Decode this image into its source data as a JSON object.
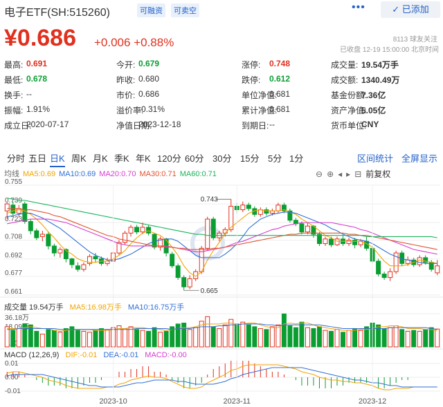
{
  "header": {
    "title": "电子ETF(SH:515260)",
    "tag_margin": "可融资",
    "tag_short": "可卖空",
    "more": "•••",
    "added_button": "✓ 已添加"
  },
  "quote": {
    "price": "¥0.686",
    "change": "+0.006 +0.88%",
    "followers": "8113 球友关注",
    "status": "已收盘 12-19 15:00:00 北京时间"
  },
  "stats": [
    {
      "label": "最高:",
      "value": "0.691",
      "tone": "red"
    },
    {
      "label": "今开:",
      "value": "0.679",
      "tone": "green"
    },
    {
      "label": "涨停:",
      "value": "0.748",
      "tone": "red"
    },
    {
      "label": "成交量:",
      "value": "19.54万手",
      "tone": "bold"
    },
    {
      "label": "最低:",
      "value": "0.678",
      "tone": "green"
    },
    {
      "label": "昨收:",
      "value": "0.680",
      "tone": "plain"
    },
    {
      "label": "跌停:",
      "value": "0.612",
      "tone": "green"
    },
    {
      "label": "成交额:",
      "value": "1340.49万",
      "tone": "bold"
    },
    {
      "label": "换手:",
      "value": "--",
      "tone": "plain"
    },
    {
      "label": "市价:",
      "value": "0.686",
      "tone": "plain"
    },
    {
      "label": "单位净值:",
      "value": "0.681",
      "tone": "plain"
    },
    {
      "label": "基金份额:",
      "value": "7.36亿",
      "tone": "bold"
    },
    {
      "label": "振幅:",
      "value": "1.91%",
      "tone": "plain"
    },
    {
      "label": "溢价率:",
      "value": "-0.31%",
      "tone": "plain"
    },
    {
      "label": "累计净值:",
      "value": "0.681",
      "tone": "plain"
    },
    {
      "label": "资产净值:",
      "value": "5.05亿",
      "tone": "bold"
    },
    {
      "label": "成立日:",
      "value": "2020-07-17",
      "tone": "plain"
    },
    {
      "label": "净值日期:",
      "value": "2023-12-18",
      "tone": "plain"
    },
    {
      "label": "到期日:",
      "value": "--",
      "tone": "plain"
    },
    {
      "label": "货币单位:",
      "value": "CNY",
      "tone": "bold"
    }
  ],
  "tabs": [
    "分时",
    "五日",
    "日K",
    "周K",
    "月K",
    "季K",
    "年K",
    "120分",
    "60分",
    "30分",
    "15分",
    "5分",
    "1分"
  ],
  "active_tab": "日K",
  "tab_links": [
    "区间统计",
    "全屏显示"
  ],
  "ma_legend": {
    "label": "均线",
    "items": [
      {
        "text": "MA5:0.69",
        "color": "#f2a300"
      },
      {
        "text": "MA10:0.69",
        "color": "#2f6fd6"
      },
      {
        "text": "MA20:0.70",
        "color": "#d83ad0"
      },
      {
        "text": "MA30:0.71",
        "color": "#e0532e"
      },
      {
        "text": "MA60:0.71",
        "color": "#19b35a"
      }
    ]
  },
  "tools": {
    "icons": [
      "⊖",
      "⊕",
      "◂",
      "▸",
      "⊟"
    ],
    "fq": "前复权"
  },
  "volume_legend": {
    "label": "成交量 19.54万手",
    "ma5": "MA5:16.98万手",
    "ma10": "MA10:16.75万手",
    "ma5_color": "#f2a300",
    "ma10_color": "#2f6fd6"
  },
  "macd_legend": {
    "label": "MACD (12,26,9)",
    "dif": "DIF:-0.01",
    "dea": "DEA:-0.01",
    "macd": "MACD:-0.00",
    "dif_color": "#f2a300",
    "dea_color": "#2f6fd6",
    "macd_color": "#d83ad0"
  },
  "chart_data": {
    "type": "candlestick",
    "y_ticks": [
      "0.755",
      "0.739",
      "0.723",
      "0.708",
      "0.692",
      "0.677",
      "0.661"
    ],
    "ylim": [
      0.661,
      0.755
    ],
    "annotations": [
      {
        "text": "0.743"
      },
      {
        "text": "0.665"
      }
    ],
    "volume_ticks": [
      "36.18万",
      "18.09万",
      "0.00"
    ],
    "volume_ylim": [
      0,
      36.18
    ],
    "macd_ticks": [
      "0.01",
      "0.00",
      "-0.01"
    ],
    "macd_ylim": [
      -0.012,
      0.012
    ],
    "x_labels": [
      "2023-10",
      "2023-11",
      "2023-12"
    ],
    "colors": {
      "up": "#e0301e",
      "down": "#0a9e32"
    },
    "candles": [
      [
        0.733,
        0.739,
        0.74,
        0.726
      ],
      [
        0.738,
        0.731,
        0.741,
        0.729
      ],
      [
        0.731,
        0.735,
        0.738,
        0.728
      ],
      [
        0.739,
        0.724,
        0.741,
        0.722
      ],
      [
        0.724,
        0.716,
        0.726,
        0.713
      ],
      [
        0.716,
        0.71,
        0.718,
        0.708
      ],
      [
        0.711,
        0.713,
        0.716,
        0.707
      ],
      [
        0.713,
        0.703,
        0.715,
        0.7
      ],
      [
        0.703,
        0.697,
        0.705,
        0.694
      ],
      [
        0.697,
        0.7,
        0.702,
        0.693
      ],
      [
        0.7,
        0.692,
        0.701,
        0.689
      ],
      [
        0.692,
        0.687,
        0.693,
        0.684
      ],
      [
        0.686,
        0.683,
        0.689,
        0.681
      ],
      [
        0.683,
        0.687,
        0.689,
        0.681
      ],
      [
        0.688,
        0.694,
        0.696,
        0.686
      ],
      [
        0.694,
        0.692,
        0.697,
        0.689
      ],
      [
        0.692,
        0.688,
        0.694,
        0.686
      ],
      [
        0.688,
        0.69,
        0.693,
        0.686
      ],
      [
        0.69,
        0.697,
        0.699,
        0.688
      ],
      [
        0.697,
        0.706,
        0.708,
        0.695
      ],
      [
        0.706,
        0.714,
        0.716,
        0.704
      ],
      [
        0.714,
        0.719,
        0.721,
        0.711
      ],
      [
        0.719,
        0.715,
        0.721,
        0.713
      ],
      [
        0.715,
        0.719,
        0.723,
        0.713
      ],
      [
        0.719,
        0.714,
        0.721,
        0.712
      ],
      [
        0.713,
        0.702,
        0.714,
        0.7
      ],
      [
        0.702,
        0.709,
        0.711,
        0.699
      ],
      [
        0.709,
        0.697,
        0.71,
        0.694
      ],
      [
        0.696,
        0.686,
        0.698,
        0.684
      ],
      [
        0.686,
        0.676,
        0.688,
        0.674
      ],
      [
        0.676,
        0.668,
        0.678,
        0.665
      ],
      [
        0.668,
        0.675,
        0.678,
        0.666
      ],
      [
        0.675,
        0.681,
        0.683,
        0.673
      ],
      [
        0.681,
        0.701,
        0.703,
        0.679
      ],
      [
        0.701,
        0.726,
        0.728,
        0.699
      ],
      [
        0.726,
        0.71,
        0.728,
        0.708
      ],
      [
        0.71,
        0.714,
        0.716,
        0.707
      ],
      [
        0.714,
        0.717,
        0.719,
        0.711
      ],
      [
        0.717,
        0.737,
        0.743,
        0.715
      ],
      [
        0.737,
        0.734,
        0.74,
        0.731
      ],
      [
        0.734,
        0.738,
        0.741,
        0.732
      ],
      [
        0.738,
        0.735,
        0.74,
        0.733
      ],
      [
        0.735,
        0.73,
        0.737,
        0.728
      ],
      [
        0.73,
        0.734,
        0.736,
        0.728
      ],
      [
        0.734,
        0.731,
        0.736,
        0.729
      ],
      [
        0.731,
        0.733,
        0.735,
        0.729
      ],
      [
        0.733,
        0.738,
        0.74,
        0.731
      ],
      [
        0.738,
        0.733,
        0.74,
        0.731
      ],
      [
        0.733,
        0.725,
        0.735,
        0.723
      ],
      [
        0.725,
        0.722,
        0.727,
        0.72
      ],
      [
        0.722,
        0.715,
        0.724,
        0.713
      ],
      [
        0.715,
        0.72,
        0.723,
        0.713
      ],
      [
        0.72,
        0.713,
        0.721,
        0.71
      ],
      [
        0.713,
        0.705,
        0.715,
        0.703
      ],
      [
        0.705,
        0.709,
        0.711,
        0.703
      ],
      [
        0.709,
        0.704,
        0.711,
        0.702
      ],
      [
        0.704,
        0.709,
        0.711,
        0.703
      ],
      [
        0.709,
        0.705,
        0.712,
        0.703
      ],
      [
        0.705,
        0.708,
        0.71,
        0.703
      ],
      [
        0.708,
        0.704,
        0.71,
        0.701
      ],
      [
        0.704,
        0.707,
        0.709,
        0.702
      ],
      [
        0.707,
        0.701,
        0.711,
        0.699
      ],
      [
        0.701,
        0.69,
        0.703,
        0.688
      ],
      [
        0.69,
        0.679,
        0.692,
        0.677
      ],
      [
        0.679,
        0.676,
        0.681,
        0.674
      ],
      [
        0.676,
        0.681,
        0.684,
        0.673
      ],
      [
        0.681,
        0.697,
        0.699,
        0.679
      ],
      [
        0.697,
        0.688,
        0.699,
        0.686
      ],
      [
        0.688,
        0.691,
        0.694,
        0.686
      ],
      [
        0.691,
        0.687,
        0.693,
        0.685
      ],
      [
        0.687,
        0.693,
        0.695,
        0.685
      ],
      [
        0.693,
        0.689,
        0.695,
        0.687
      ],
      [
        0.689,
        0.683,
        0.691,
        0.681
      ],
      [
        0.68,
        0.686,
        0.691,
        0.678
      ]
    ],
    "ma5": [
      0.731,
      0.733,
      0.734,
      0.733,
      0.73,
      0.726,
      0.721,
      0.715,
      0.71,
      0.704,
      0.699,
      0.696,
      0.692,
      0.69,
      0.689,
      0.689,
      0.69,
      0.69,
      0.692,
      0.695,
      0.699,
      0.705,
      0.71,
      0.714,
      0.716,
      0.714,
      0.712,
      0.708,
      0.702,
      0.695,
      0.686,
      0.68,
      0.677,
      0.681,
      0.691,
      0.699,
      0.706,
      0.714,
      0.719,
      0.723,
      0.727,
      0.731,
      0.733,
      0.734,
      0.733,
      0.733,
      0.733,
      0.734,
      0.732,
      0.73,
      0.726,
      0.723,
      0.72,
      0.716,
      0.712,
      0.71,
      0.707,
      0.707,
      0.707,
      0.707,
      0.707,
      0.705,
      0.702,
      0.696,
      0.69,
      0.686,
      0.686,
      0.686,
      0.687,
      0.689,
      0.691,
      0.69,
      0.689,
      0.688
    ],
    "ma10": [
      0.728,
      0.729,
      0.73,
      0.731,
      0.731,
      0.729,
      0.727,
      0.724,
      0.721,
      0.718,
      0.714,
      0.71,
      0.706,
      0.702,
      0.698,
      0.695,
      0.693,
      0.691,
      0.691,
      0.692,
      0.694,
      0.696,
      0.699,
      0.702,
      0.705,
      0.707,
      0.708,
      0.709,
      0.709,
      0.707,
      0.703,
      0.699,
      0.695,
      0.693,
      0.693,
      0.693,
      0.693,
      0.696,
      0.7,
      0.705,
      0.711,
      0.718,
      0.722,
      0.726,
      0.728,
      0.73,
      0.731,
      0.732,
      0.732,
      0.731,
      0.729,
      0.727,
      0.725,
      0.723,
      0.721,
      0.718,
      0.716,
      0.713,
      0.711,
      0.709,
      0.708,
      0.707,
      0.705,
      0.702,
      0.699,
      0.696,
      0.694,
      0.692,
      0.691,
      0.69,
      0.689,
      0.688,
      0.688,
      0.688
    ],
    "ma20": [
      0.722,
      0.723,
      0.724,
      0.725,
      0.726,
      0.726,
      0.726,
      0.726,
      0.725,
      0.724,
      0.723,
      0.721,
      0.719,
      0.717,
      0.715,
      0.713,
      0.711,
      0.709,
      0.707,
      0.705,
      0.704,
      0.703,
      0.703,
      0.703,
      0.703,
      0.703,
      0.703,
      0.703,
      0.702,
      0.701,
      0.7,
      0.699,
      0.698,
      0.698,
      0.699,
      0.7,
      0.701,
      0.702,
      0.704,
      0.706,
      0.707,
      0.709,
      0.711,
      0.713,
      0.715,
      0.717,
      0.718,
      0.72,
      0.721,
      0.722,
      0.723,
      0.723,
      0.723,
      0.723,
      0.723,
      0.723,
      0.722,
      0.721,
      0.72,
      0.719,
      0.717,
      0.716,
      0.714,
      0.712,
      0.71,
      0.708,
      0.706,
      0.704,
      0.702,
      0.7,
      0.699,
      0.698,
      0.697,
      0.696
    ],
    "ma30": [
      0.735,
      0.735,
      0.735,
      0.734,
      0.734,
      0.733,
      0.732,
      0.731,
      0.729,
      0.728,
      0.726,
      0.724,
      0.722,
      0.72,
      0.718,
      0.716,
      0.714,
      0.712,
      0.711,
      0.709,
      0.708,
      0.707,
      0.706,
      0.705,
      0.704,
      0.703,
      0.703,
      0.702,
      0.702,
      0.701,
      0.701,
      0.7,
      0.7,
      0.7,
      0.7,
      0.701,
      0.701,
      0.702,
      0.703,
      0.704,
      0.705,
      0.706,
      0.707,
      0.708,
      0.709,
      0.71,
      0.711,
      0.712,
      0.713,
      0.713,
      0.714,
      0.714,
      0.714,
      0.714,
      0.714,
      0.714,
      0.714,
      0.714,
      0.713,
      0.713,
      0.712,
      0.712,
      0.711,
      0.71,
      0.709,
      0.708,
      0.707,
      0.706,
      0.705,
      0.704,
      0.703,
      0.702,
      0.701,
      0.7
    ],
    "ma60": [
      0.744,
      0.743,
      0.742,
      0.742,
      0.741,
      0.74,
      0.739,
      0.738,
      0.737,
      0.736,
      0.735,
      0.734,
      0.733,
      0.732,
      0.731,
      0.73,
      0.729,
      0.728,
      0.727,
      0.726,
      0.725,
      0.724,
      0.723,
      0.722,
      0.721,
      0.72,
      0.719,
      0.718,
      0.717,
      0.716,
      0.715,
      0.714,
      0.713,
      0.713,
      0.712,
      0.712,
      0.712,
      0.712,
      0.712,
      0.712,
      0.712,
      0.712,
      0.712,
      0.712,
      0.712,
      0.712,
      0.712,
      0.712,
      0.712,
      0.712,
      0.712,
      0.712,
      0.712,
      0.712,
      0.712,
      0.712,
      0.712,
      0.712,
      0.712,
      0.712,
      0.712,
      0.711,
      0.711,
      0.711,
      0.711,
      0.711,
      0.711,
      0.711,
      0.711,
      0.711,
      0.711,
      0.711,
      0.711,
      0.71
    ],
    "volume": [
      22,
      18,
      20,
      25,
      24,
      17,
      14,
      19,
      18,
      16,
      20,
      22,
      18,
      17,
      16,
      18,
      20,
      19,
      21,
      23,
      20,
      22,
      19,
      18,
      17,
      21,
      16,
      17,
      22,
      25,
      26,
      19,
      21,
      28,
      33,
      22,
      20,
      24,
      30,
      25,
      27,
      24,
      22,
      20,
      19,
      22,
      24,
      36,
      23,
      21,
      27,
      21,
      20,
      22,
      18,
      17,
      19,
      16,
      18,
      20,
      18,
      22,
      26,
      24,
      20,
      21,
      23,
      19,
      17,
      18,
      17,
      19,
      21,
      19.5
    ],
    "vol_ma5": [
      20,
      20,
      20,
      21,
      22,
      21,
      20,
      20,
      18,
      17,
      18,
      19,
      19,
      19,
      19,
      18,
      18,
      18,
      19,
      20,
      20,
      21,
      21,
      21,
      20,
      20,
      19,
      18,
      19,
      20,
      21,
      21,
      22,
      24,
      25,
      25,
      25,
      26,
      26,
      24,
      25,
      26,
      26,
      24,
      22,
      21,
      21,
      25,
      26,
      25,
      26,
      26,
      24,
      22,
      21,
      20,
      19,
      18,
      18,
      18,
      19,
      19,
      20,
      22,
      22,
      23,
      23,
      22,
      20,
      20,
      20,
      19,
      19,
      18
    ],
    "vol_ma10": [
      19,
      19,
      20,
      20,
      20,
      20,
      20,
      20,
      20,
      19,
      19,
      19,
      19,
      19,
      19,
      19,
      19,
      19,
      19,
      19,
      19,
      19,
      20,
      20,
      20,
      20,
      20,
      20,
      19,
      20,
      20,
      20,
      21,
      22,
      22,
      22,
      23,
      23,
      24,
      24,
      25,
      25,
      25,
      25,
      24,
      24,
      23,
      24,
      24,
      24,
      24,
      24,
      24,
      24,
      23,
      22,
      21,
      20,
      20,
      20,
      20,
      20,
      20,
      20,
      20,
      21,
      21,
      21,
      21,
      21,
      21,
      21,
      20,
      19
    ],
    "dif": [
      0.003,
      0.004,
      0.004,
      0.003,
      0.002,
      0.001,
      0.0,
      -0.002,
      -0.003,
      -0.004,
      -0.006,
      -0.007,
      -0.008,
      -0.008,
      -0.008,
      -0.008,
      -0.008,
      -0.007,
      -0.007,
      -0.005,
      -0.004,
      -0.002,
      -0.001,
      0.0,
      0.001,
      0.0,
      0.0,
      -0.001,
      -0.003,
      -0.005,
      -0.007,
      -0.008,
      -0.008,
      -0.007,
      -0.004,
      -0.002,
      0.0,
      0.002,
      0.005,
      0.006,
      0.008,
      0.009,
      0.009,
      0.009,
      0.009,
      0.009,
      0.009,
      0.008,
      0.007,
      0.006,
      0.004,
      0.003,
      0.002,
      0.0,
      -0.001,
      -0.002,
      -0.002,
      -0.003,
      -0.003,
      -0.004,
      -0.004,
      -0.005,
      -0.006,
      -0.008,
      -0.009,
      -0.009,
      -0.008,
      -0.008,
      -0.008,
      -0.007,
      -0.007,
      -0.007,
      -0.007,
      -0.007
    ],
    "dea": [
      0.001,
      0.002,
      0.002,
      0.002,
      0.002,
      0.002,
      0.002,
      0.001,
      0.0,
      -0.001,
      -0.002,
      -0.003,
      -0.004,
      -0.005,
      -0.006,
      -0.006,
      -0.007,
      -0.007,
      -0.007,
      -0.007,
      -0.006,
      -0.005,
      -0.004,
      -0.004,
      -0.003,
      -0.002,
      -0.002,
      -0.002,
      -0.002,
      -0.003,
      -0.003,
      -0.004,
      -0.005,
      -0.005,
      -0.005,
      -0.005,
      -0.004,
      -0.003,
      -0.001,
      0.0,
      0.002,
      0.003,
      0.004,
      0.005,
      0.006,
      0.007,
      0.007,
      0.007,
      0.007,
      0.007,
      0.007,
      0.006,
      0.005,
      0.004,
      0.003,
      0.002,
      0.001,
      0.0,
      -0.001,
      -0.002,
      -0.002,
      -0.003,
      -0.004,
      -0.004,
      -0.005,
      -0.006,
      -0.006,
      -0.007,
      -0.007,
      -0.007,
      -0.007,
      -0.007,
      -0.007,
      -0.007
    ]
  }
}
